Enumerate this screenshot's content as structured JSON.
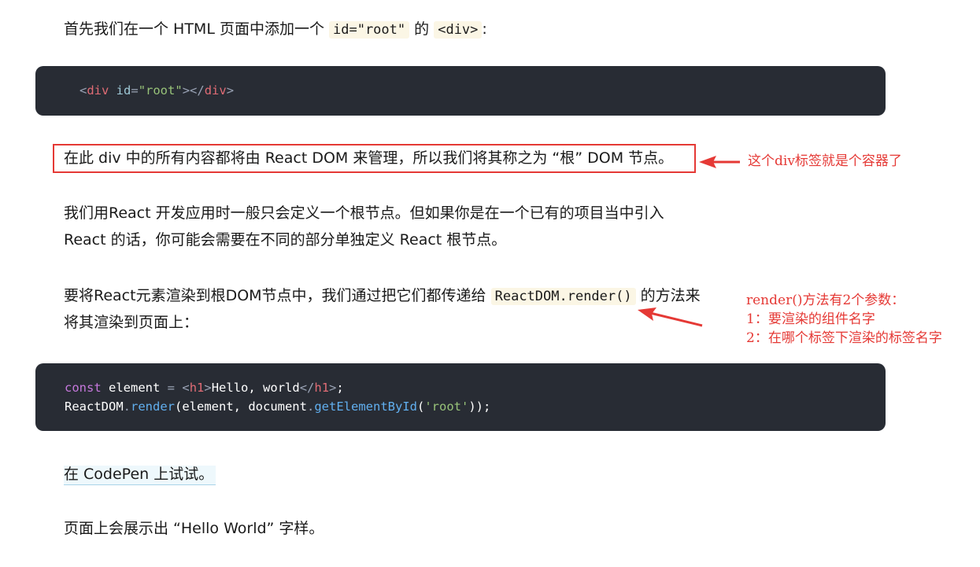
{
  "intro": {
    "text1": "首先我们在一个 HTML 页面中添加一个 ",
    "code1": "id=\"root\"",
    "text2": " 的 ",
    "code2": "<div>",
    "text3": ":"
  },
  "code_block_1": {
    "lt": "<",
    "tag": "div",
    "attr": " id",
    "eq": "=",
    "val": "\"root\"",
    "gt": ">",
    "close_lt": "</",
    "close_tag": "div",
    "close_gt": ">"
  },
  "highlight_para": "在此 div 中的所有内容都将由 React DOM 来管理，所以我们将其称之为 “根” DOM 节点。",
  "annotation_1": "这个div标签就是个容器了",
  "para2": {
    "line1": "我们用React 开发应用时一般只会定义一个根节点。但如果你是在一个已有的项目当中引入",
    "line2": "React 的话，你可能会需要在不同的部分单独定义 React 根节点。"
  },
  "para3": {
    "text1": "要将React元素渲染到根DOM节点中，我们通过把它们都传递给 ",
    "code": "ReactDOM.render()",
    "text2": " 的方法来",
    "line2": "将其渲染到页面上："
  },
  "annotation_2": {
    "line1": "render()方法有2个参数：",
    "line2": "1：要渲染的组件名字",
    "line3": "2：在哪个标签下渲染的标签名字"
  },
  "code_block_2": {
    "l1_kw": "const",
    "l1_var": " element ",
    "l1_eq": "=",
    "l1_sp": " ",
    "l1_lt": "<",
    "l1_tag": "h1",
    "l1_gt": ">",
    "l1_text": "Hello, world",
    "l1_clt": "</",
    "l1_ctag": "h1",
    "l1_cgt": ">",
    "l1_semi": ";",
    "l2_obj": "ReactDOM",
    "l2_dot": ".",
    "l2_fn": "render",
    "l2_args1": "(element, document",
    "l2_dot2": ".",
    "l2_fn2": "getElementById",
    "l2_paren": "(",
    "l2_str": "'root'",
    "l2_end": "));"
  },
  "codepen_link": "在 CodePen 上试试。",
  "final_para": "页面上会展示出 “Hello World” 字样。",
  "colors": {
    "annotation": "#e53935",
    "code_bg": "#282c34",
    "inline_code_bg": "#fbf6e5"
  }
}
